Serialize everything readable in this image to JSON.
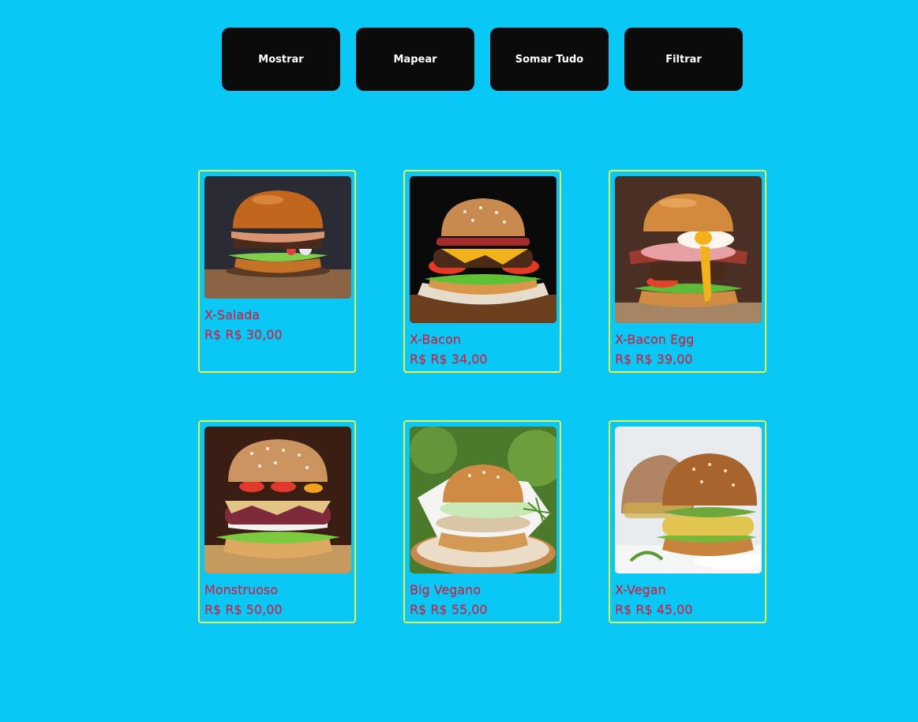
{
  "toolbar": {
    "buttons": [
      {
        "label": "Mostrar"
      },
      {
        "label": "Mapear"
      },
      {
        "label": "Somar Tudo"
      },
      {
        "label": "Filtrar"
      }
    ]
  },
  "products": [
    {
      "name": "X-Salada",
      "price": "R$ R$ 30,00",
      "image": "burger-image"
    },
    {
      "name": "X-Bacon",
      "price": "R$ R$ 34,00",
      "image": "burger-image"
    },
    {
      "name": "X-Bacon Egg",
      "price": "R$ R$ 39,00",
      "image": "burger-image"
    },
    {
      "name": "Monstruoso",
      "price": "R$ R$ 50,00",
      "image": "burger-image"
    },
    {
      "name": "Big Vegano",
      "price": "R$ R$ 55,00",
      "image": "burger-image"
    },
    {
      "name": "X-Vegan",
      "price": "R$ R$ 45,00",
      "image": "burger-image"
    }
  ],
  "colors": {
    "background": "#0ac8f5",
    "button_bg": "#0b0b0b",
    "button_text": "#ffffff",
    "card_border": "#e6f24a",
    "text_accent": "#e0163c"
  }
}
